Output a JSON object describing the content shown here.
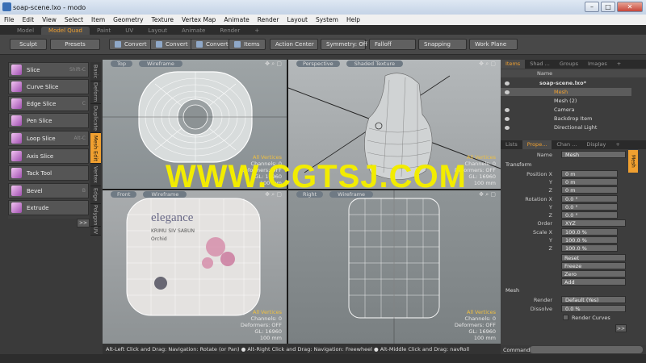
{
  "window": {
    "title": "soap-scene.lxo - modo"
  },
  "menu": [
    "File",
    "Edit",
    "View",
    "Select",
    "Item",
    "Geometry",
    "Texture",
    "Vertex Map",
    "Animate",
    "Render",
    "Layout",
    "System",
    "Help"
  ],
  "layout_tabs": [
    "Model",
    "Model Quad",
    "Paint",
    "UV",
    "Layout",
    "Animate",
    "Render",
    "+"
  ],
  "toolbar": {
    "sculpt": "Sculpt",
    "presets": "Presets",
    "convert1": "Convert",
    "convert2": "Convert",
    "convert3": "Convert",
    "items": "Items",
    "action_center": "Action Center",
    "symmetry": "Symmetry: Off",
    "falloff": "Falloff",
    "snapping": "Snapping",
    "work_plane": "Work Plane"
  },
  "tools": [
    {
      "label": "Slice",
      "shortcut": "Shift-C"
    },
    {
      "label": "Curve Slice",
      "shortcut": ""
    },
    {
      "label": "Edge Slice",
      "shortcut": "C"
    },
    {
      "label": "Pen Slice",
      "shortcut": ""
    },
    {
      "label": "Loop Slice",
      "shortcut": "Alt-C"
    },
    {
      "label": "Axis Slice",
      "shortcut": ""
    },
    {
      "label": "Tack Tool",
      "shortcut": ""
    },
    {
      "label": "Bevel",
      "shortcut": "B"
    },
    {
      "label": "Extrude",
      "shortcut": ""
    }
  ],
  "more_label": ">>",
  "vertical_tabs": [
    "Basic",
    "Deform",
    "Duplicate",
    "Mesh Edit",
    "Vertex",
    "Edge",
    "Polygon",
    "UV"
  ],
  "viewports": [
    {
      "view": "Top",
      "mode": "Wireframe",
      "selection": "All Vertices",
      "channels": "Channels: 0",
      "deformers": "Deformers: OFF",
      "gl": "GL: 16960",
      "scale": "100 mm"
    },
    {
      "view": "Perspective",
      "mode": "Shaded Texture",
      "selection": "All Vertices",
      "channels": "Channels: 0",
      "deformers": "Deformers: OFF",
      "gl": "GL: 16960",
      "scale": "100 mm"
    },
    {
      "view": "Front",
      "mode": "Wireframe",
      "selection": "All Vertices",
      "channels": "Channels: 0",
      "deformers": "Deformers: OFF",
      "gl": "GL: 16960",
      "scale": "100 mm"
    },
    {
      "view": "Right",
      "mode": "Wireframe",
      "selection": "All Vertices",
      "channels": "Channels: 0",
      "deformers": "Deformers: OFF",
      "gl": "GL: 16960",
      "scale": "100 mm"
    }
  ],
  "soap_label": {
    "brand": "elegance",
    "line": "KRIMU SIV SABUN",
    "sub": "Orchid"
  },
  "status_hint": "Alt-Left Click and Drag: Navigation: Rotate (or Pan) ● Alt-Right Click and Drag: Navigation: Freewheel ● Alt-Middle Click and Drag: navRoll",
  "items_panel": {
    "tabs": [
      "Items",
      "Shad ...",
      "Groups",
      "Images",
      "+"
    ],
    "column": "Name",
    "rows": [
      {
        "label": "soap-scene.lxo*"
      },
      {
        "label": "Mesh"
      },
      {
        "label": "Mesh (2)"
      },
      {
        "label": "Camera"
      },
      {
        "label": "Backdrop Item"
      },
      {
        "label": "Directional Light"
      }
    ]
  },
  "props_panel": {
    "tabs": [
      "Lists",
      "Prope...",
      "Chan ...",
      "Display",
      "+"
    ],
    "name_label": "Name",
    "name_value": "Mesh",
    "transform_label": "Transform",
    "position_label": "Position X",
    "position": [
      "0 m",
      "0 m",
      "0 m"
    ],
    "rotation_label": "Rotation X",
    "rotation": [
      "0.0 °",
      "0.0 °",
      "0.0 °"
    ],
    "order_label": "Order",
    "order": "XYZ",
    "scale_label": "Scale X",
    "scale": [
      "100.0 %",
      "100.0 %",
      "100.0 %"
    ],
    "axis_y": "Y",
    "axis_z": "Z",
    "buttons": [
      "Reset",
      "Freeze",
      "Zero",
      "Add"
    ],
    "mesh_label": "Mesh",
    "render_label": "Render",
    "render_value": "Default (Yes)",
    "dissolve_label": "Dissolve",
    "dissolve_value": "0.0 %",
    "render_curves": "Render Curves",
    "side_tab": "Mesh"
  },
  "command_label": "Command",
  "watermark": "WWW.CGTSJ.COM"
}
